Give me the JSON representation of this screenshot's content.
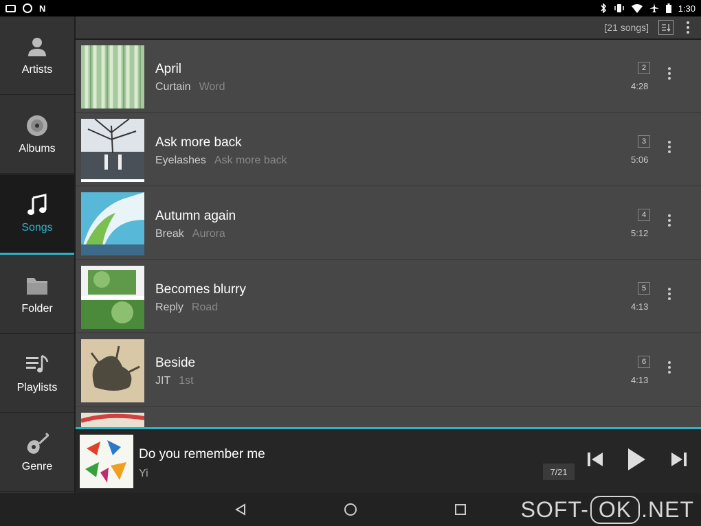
{
  "status_bar": {
    "time": "1:30",
    "left_icons": [
      "image-notification-icon",
      "sync-icon",
      "n-icon"
    ],
    "right_icons": [
      "bluetooth-icon",
      "vibrate-icon",
      "wifi-icon",
      "airplane-icon",
      "battery-icon"
    ]
  },
  "sidebar": {
    "items": [
      {
        "label": "Artists",
        "icon": "artist-icon",
        "active": false
      },
      {
        "label": "Albums",
        "icon": "album-icon",
        "active": false
      },
      {
        "label": "Songs",
        "icon": "music-note-icon",
        "active": true
      },
      {
        "label": "Folder",
        "icon": "folder-icon",
        "active": false
      },
      {
        "label": "Playlists",
        "icon": "playlist-icon",
        "active": false
      },
      {
        "label": "Genre",
        "icon": "guitar-icon",
        "active": false
      }
    ]
  },
  "header": {
    "count": "[21 songs]"
  },
  "songs": [
    {
      "title": "April",
      "artist": "Curtain",
      "album": "Word",
      "track": "2",
      "duration": "4:28"
    },
    {
      "title": "Ask more back",
      "artist": "Eyelashes",
      "album": "Ask more back",
      "track": "3",
      "duration": "5:06"
    },
    {
      "title": "Autumn again",
      "artist": "Break",
      "album": "Aurora",
      "track": "4",
      "duration": "5:12"
    },
    {
      "title": "Becomes blurry",
      "artist": "Reply",
      "album": "Road",
      "track": "5",
      "duration": "4:13"
    },
    {
      "title": "Beside",
      "artist": "JIT",
      "album": "1st",
      "track": "6",
      "duration": "4:13"
    }
  ],
  "now_playing": {
    "title": "Do you remember me",
    "artist": "Yi",
    "position": "7/21"
  },
  "watermark": {
    "left": "SOFT-",
    "box": "OK",
    "right": ".NET"
  },
  "colors": {
    "accent": "#2bb3c8",
    "background": "#444444",
    "sidebar": "#333333"
  }
}
